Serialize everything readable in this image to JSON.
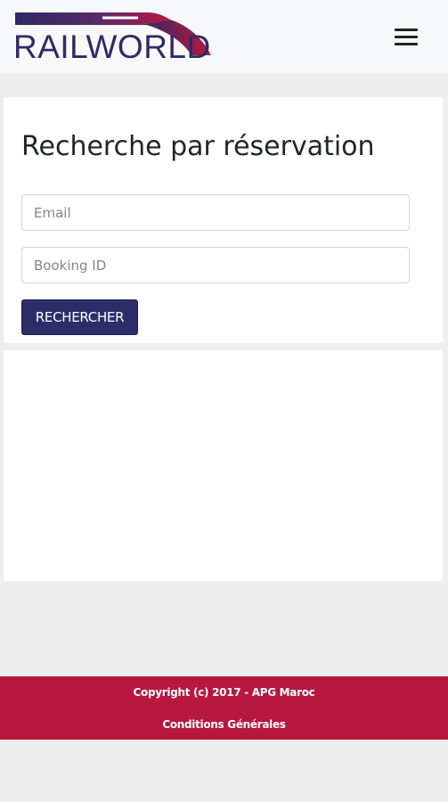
{
  "header": {
    "logo_text": "RAILWORLD",
    "menu_icon": "hamburger-menu-icon",
    "colors": {
      "logo_navy": "#2d2a64",
      "logo_crimson": "#b81740"
    }
  },
  "search": {
    "title": "Recherche par réservation",
    "email_placeholder": "Email",
    "email_value": "",
    "booking_placeholder": "Booking ID",
    "booking_value": "",
    "button_label": "RECHERCHER",
    "button_color": "#2d2d6a"
  },
  "footer": {
    "copyright": "Copyright (c) 2017 - APG Maroc",
    "terms_link": "Conditions Générales",
    "background_color": "#b81740"
  }
}
